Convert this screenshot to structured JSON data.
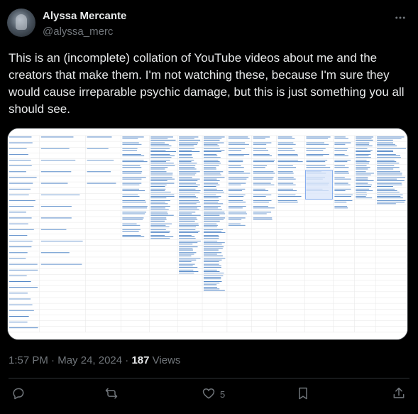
{
  "author": {
    "display_name": "Alyssa Mercante",
    "handle": "@alyssa_merc"
  },
  "icons": {
    "more": "more-horizontal-icon",
    "reply": "reply-icon",
    "retweet": "retweet-icon",
    "like": "heart-icon",
    "bookmark": "bookmark-icon",
    "share": "share-icon"
  },
  "tweet": {
    "text": "This is an (incomplete) collation of YouTube videos about me and the creators that make them. I'm not watching these, because I'm sure they would cause irreparable psychic damage, but this is just something you all should see.",
    "time": "1:57 PM",
    "separator": "·",
    "date": "May 24, 2024",
    "views_count": "187",
    "views_label": "Views"
  },
  "actions": {
    "like_count": "5"
  },
  "colors": {
    "background": "#000000",
    "text": "#e7e9ea",
    "muted": "#71767b",
    "link": "#1a5fb4"
  }
}
